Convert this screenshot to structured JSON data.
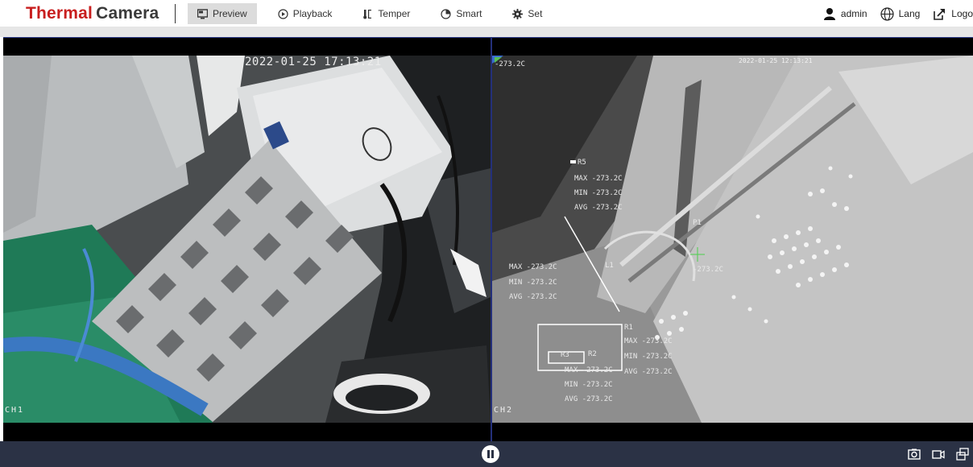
{
  "brand": {
    "part1": "Thermal",
    "part2": "Camera"
  },
  "nav": [
    {
      "label": "Preview",
      "icon": "monitor-icon",
      "active": true
    },
    {
      "label": "Playback",
      "icon": "playback-icon",
      "active": false
    },
    {
      "label": "Temper",
      "icon": "thermometer-icon",
      "active": false
    },
    {
      "label": "Smart",
      "icon": "pie-icon",
      "active": false
    },
    {
      "label": "Set",
      "icon": "gear-icon",
      "active": false
    }
  ],
  "tools": {
    "user": "admin",
    "lang": "Lang",
    "logout": "Logo"
  },
  "left_view": {
    "timestamp": "2022-01-25 17:13:21",
    "channel": "CH1"
  },
  "right_view": {
    "timestamp": "2022-01-25 12:13:21",
    "channel": "CH2",
    "corner_temp": "-273.2C",
    "r5": {
      "label": "R5",
      "max": "MAX -273.2C",
      "min": "MIN -273.2C",
      "avg": "AVG -273.2C"
    },
    "l1": {
      "label": "L1",
      "max": "MAX -273.2C",
      "min": "MIN -273.2C",
      "avg": "AVG -273.2C"
    },
    "p1": {
      "label": "P1",
      "temp": "-273.2C"
    },
    "r1": {
      "label": "R1",
      "max": "MAX -273.2C",
      "min": "MIN -273.2C",
      "avg": "AVG -273.2C"
    },
    "r2": {
      "label": "R2"
    },
    "r3": {
      "label": "R3",
      "max": "MAX -273.2C",
      "min": "MIN -273.2C",
      "avg": "AVG -273.2C"
    }
  },
  "colors": {
    "accent": "#c81e1e",
    "bottom_bar": "#2b3245",
    "divider": "#24307a"
  }
}
